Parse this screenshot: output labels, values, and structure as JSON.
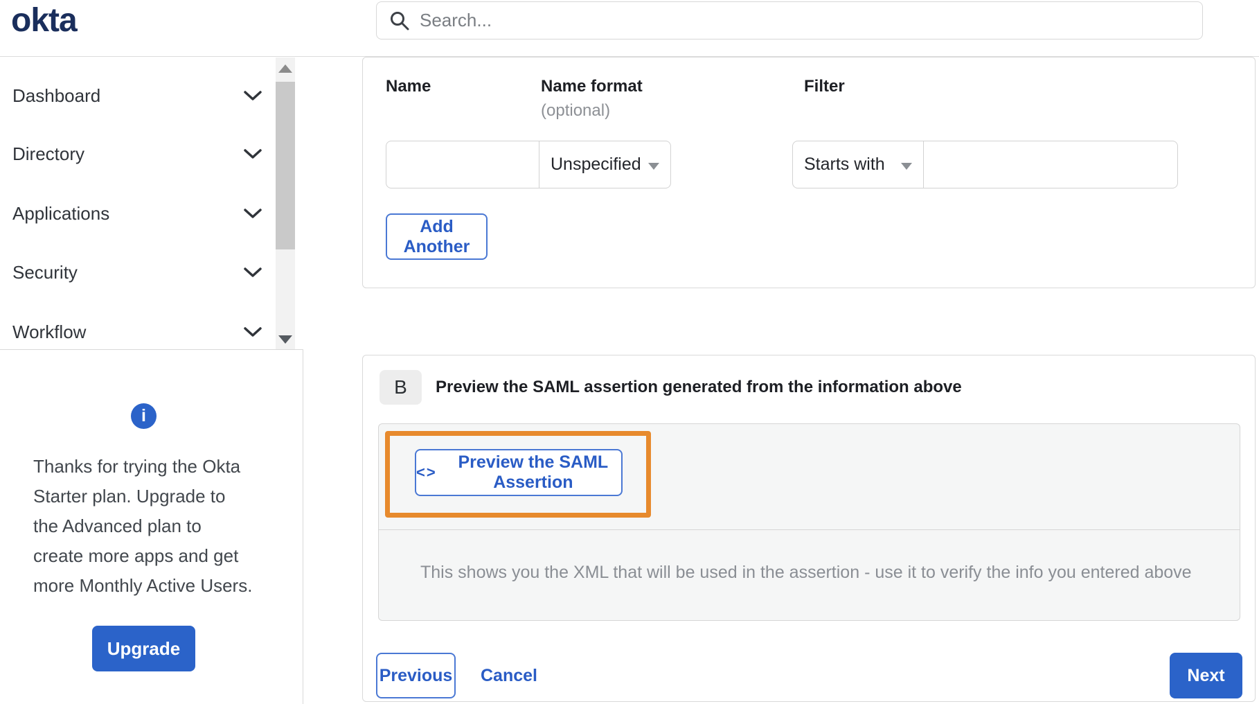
{
  "header": {
    "logo": "okta",
    "search_placeholder": "Search..."
  },
  "sidebar": {
    "items": [
      {
        "label": "Dashboard"
      },
      {
        "label": "Directory"
      },
      {
        "label": "Applications"
      },
      {
        "label": "Security"
      },
      {
        "label": "Workflow"
      }
    ],
    "promo": {
      "lines": [
        "Thanks for trying the Okta",
        "Starter plan. Upgrade to",
        "the Advanced plan to",
        "create more apps and get",
        "more Monthly Active Users."
      ],
      "upgrade_label": "Upgrade"
    }
  },
  "attribute_form": {
    "name_label": "Name",
    "name_format_label": "Name format",
    "name_format_optional": "(optional)",
    "filter_label": "Filter",
    "name_value": "",
    "name_format_value": "Unspecified",
    "filter_type_value": "Starts with",
    "filter_value": "",
    "add_another_label": "Add Another"
  },
  "preview_section": {
    "step_badge": "B",
    "heading": "Preview the SAML assertion generated from the information above",
    "preview_button_icon": "<>",
    "preview_button_label": "Preview the SAML Assertion",
    "note": "This shows you the XML that will be used in the assertion - use it to verify the info you entered above"
  },
  "footer": {
    "previous_label": "Previous",
    "cancel_label": "Cancel",
    "next_label": "Next"
  },
  "colors": {
    "accent_blue": "#2b63c9",
    "link_blue": "#2a5cc5",
    "annotation_orange": "#e78a2d",
    "logo_navy": "#1a2e5c"
  }
}
